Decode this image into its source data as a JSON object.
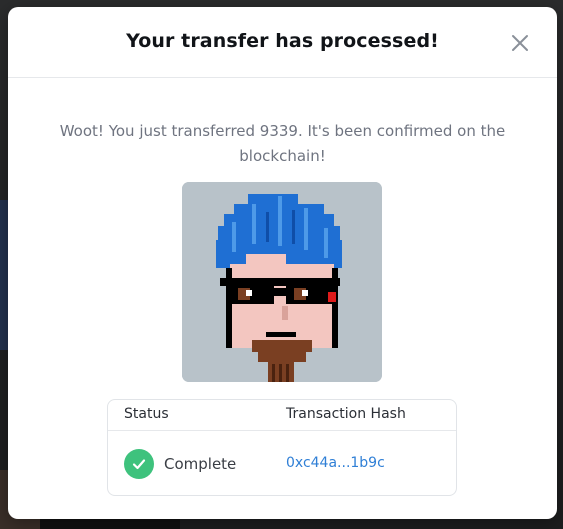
{
  "modal": {
    "title": "Your transfer has processed!",
    "close_icon": "close-icon",
    "message": "Woot! You just transferred 9339. It's been confirmed on the blockchain!"
  },
  "nft": {
    "image_icon": "pixel-avatar-icon",
    "background_color": "#b8c2c9"
  },
  "transaction": {
    "headers": {
      "status": "Status",
      "hash": "Transaction Hash"
    },
    "status_value": "Complete",
    "status_icon": "check-circle-icon",
    "status_color": "#3ec27d",
    "hash_value": "0xc44a...1b9c",
    "hash_color": "#2f7fd6"
  }
}
